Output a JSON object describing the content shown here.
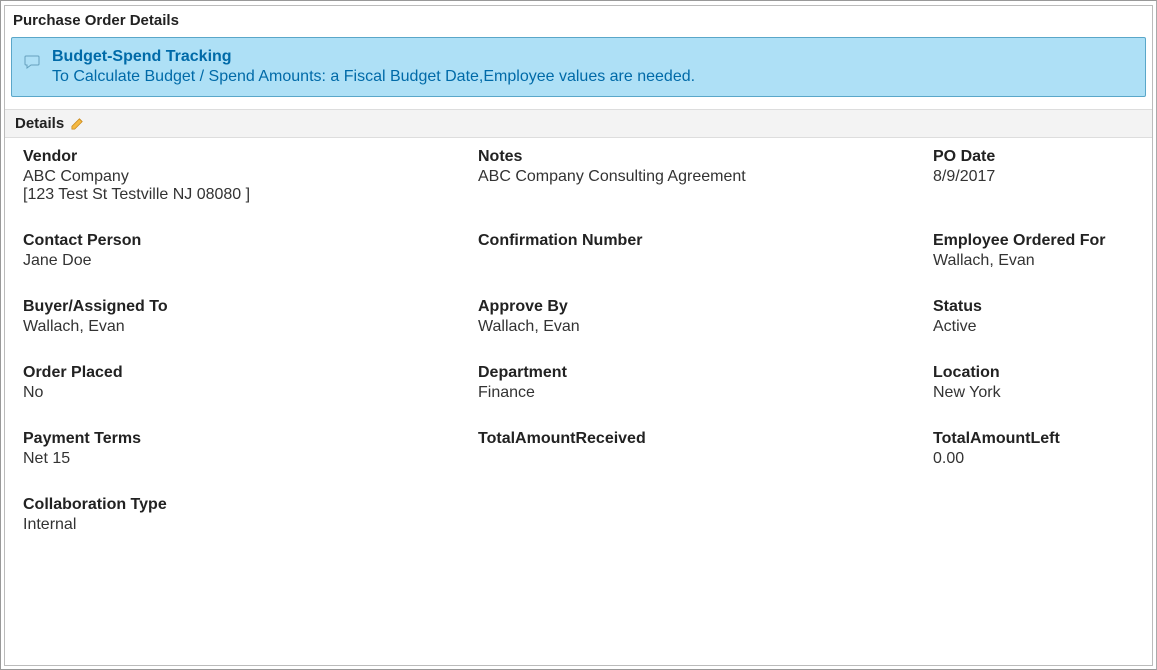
{
  "panel_title": "Purchase Order Details",
  "alert": {
    "title": "Budget-Spend Tracking",
    "message": "To Calculate Budget / Spend Amounts: a Fiscal Budget Date,Employee values are needed."
  },
  "section_header": "Details",
  "fields": {
    "vendor": {
      "label": "Vendor",
      "value": "ABC Company",
      "address": "[123 Test St Testville NJ 08080 ]"
    },
    "notes": {
      "label": "Notes",
      "value": "ABC Company Consulting Agreement"
    },
    "po_date": {
      "label": "PO Date",
      "value": "8/9/2017"
    },
    "contact_person": {
      "label": "Contact Person",
      "value": "Jane Doe"
    },
    "confirmation_number": {
      "label": "Confirmation Number",
      "value": ""
    },
    "employee_ordered_for": {
      "label": "Employee Ordered For",
      "value": "Wallach, Evan"
    },
    "buyer_assigned_to": {
      "label": "Buyer/Assigned To",
      "value": "Wallach, Evan"
    },
    "approve_by": {
      "label": "Approve By",
      "value": "Wallach, Evan"
    },
    "status": {
      "label": "Status",
      "value": "Active"
    },
    "order_placed": {
      "label": "Order Placed",
      "value": "No"
    },
    "department": {
      "label": "Department",
      "value": "Finance"
    },
    "location": {
      "label": "Location",
      "value": "New York"
    },
    "payment_terms": {
      "label": "Payment Terms",
      "value": "Net 15"
    },
    "total_amount_received": {
      "label": "TotalAmountReceived",
      "value": ""
    },
    "total_amount_left": {
      "label": "TotalAmountLeft",
      "value": "0.00"
    },
    "collaboration_type": {
      "label": "Collaboration Type",
      "value": "Internal"
    }
  }
}
